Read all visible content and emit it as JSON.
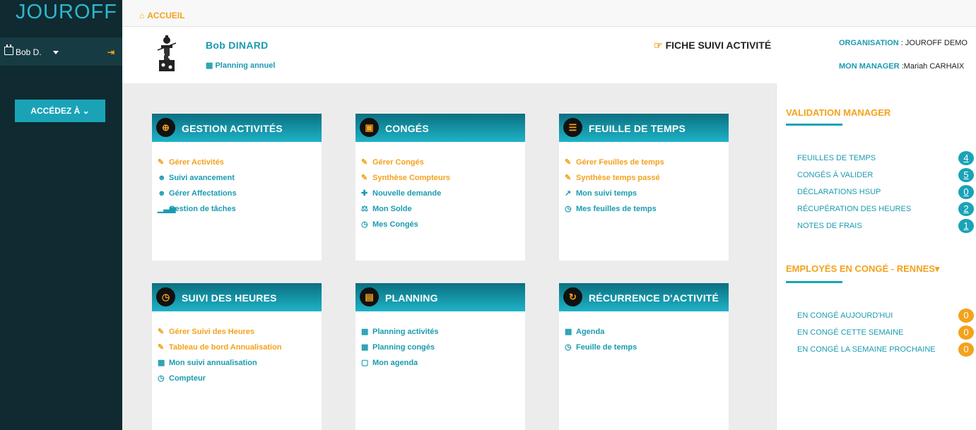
{
  "app": {
    "logo": "JOUROFF"
  },
  "sidebar": {
    "user": "Bob D.",
    "access_button": "ACCÉDEZ À ⌄"
  },
  "breadcrumb": {
    "home": "ACCUEIL"
  },
  "profile": {
    "name": "Bob DINARD",
    "planning_link": "Planning annuel",
    "fiche": "FICHE SUIVI ACTIVITÉ",
    "org_label": "ORGANISATION",
    "org_value": " : JOUROFF DEMO",
    "mgr_label": "MON MANAGER",
    "mgr_value": " :Mariah CARHAIX"
  },
  "cards": {
    "gestion": {
      "title": "GESTION ACTIVITÉS",
      "items": [
        "Gérer Activités",
        "Suivi avancement",
        "Gérer Affectations",
        "Gestion de tâches"
      ]
    },
    "conges": {
      "title": "CONGÉS",
      "items": [
        "Gérer Congés",
        "Synthèse Compteurs",
        "Nouvelle demande",
        "Mon Solde",
        "Mes Congés"
      ]
    },
    "feuille": {
      "title": "FEUILLE DE TEMPS",
      "items": [
        "Gérer Feuilles de temps",
        "Synthèse temps passé",
        "Mon suivi temps",
        "Mes feuilles de temps"
      ]
    },
    "heures": {
      "title": "SUIVI DES HEURES",
      "items": [
        "Gérer Suivi des Heures",
        "Tableau de bord Annualisation",
        "Mon suivi annualisation",
        "Compteur"
      ]
    },
    "planning": {
      "title": "PLANNING",
      "items": [
        "Planning activités",
        "Planning congés",
        "Mon agenda"
      ]
    },
    "recurrence": {
      "title": "RÉCURRENCE D'ACTIVITÉ",
      "items": [
        "Agenda",
        "Feuille de temps"
      ]
    }
  },
  "right_panel": {
    "validation_title": "VALIDATION MANAGER",
    "validation": [
      {
        "label": "FEUILLES DE TEMPS",
        "count": "4"
      },
      {
        "label": "CONGÉS À VALIDER",
        "count": "5"
      },
      {
        "label": "DÉCLARATIONS HSUP",
        "count": "0"
      },
      {
        "label": "RÉCUPÉRATION DES HEURES",
        "count": "2"
      },
      {
        "label": "NOTES DE FRAIS",
        "count": "1"
      }
    ],
    "conge_title": "EMPLOYÉS EN CONGÉ - RENNES",
    "conge": [
      {
        "label": "EN CONGÉ AUJOURD'HUI",
        "count": "0"
      },
      {
        "label": "EN CONGÉ CETTE SEMAINE",
        "count": "0"
      },
      {
        "label": "EN CONGÉ LA SEMAINE PROCHAINE",
        "count": "0"
      }
    ]
  },
  "colors": {
    "accent": "#1aa3b7",
    "orange": "#f3a21c",
    "sidebar": "#0f2a30"
  }
}
